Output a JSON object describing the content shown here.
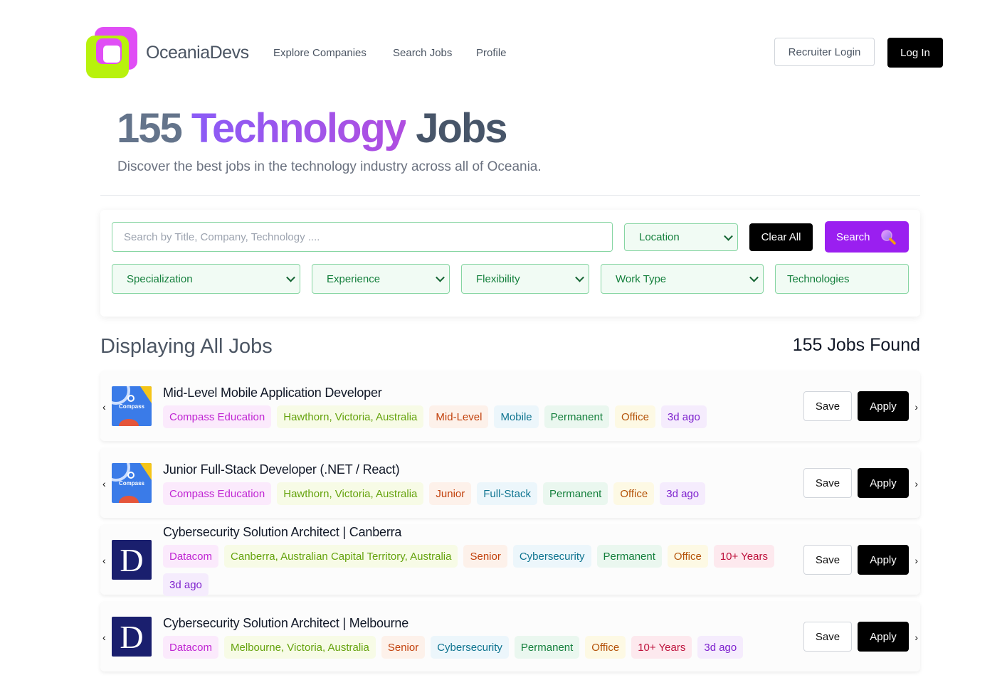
{
  "nav": {
    "brand": "OceaniaDevs",
    "links": [
      "Explore Companies",
      "Search Jobs",
      "Profile"
    ],
    "recruiter_login": "Recruiter Login",
    "log_in": "Log In"
  },
  "hero": {
    "count": "155",
    "accent": "Technology",
    "word": "Jobs",
    "subtitle": "Discover the best jobs in the technology industry across all of Oceania."
  },
  "filters": {
    "search_placeholder": "Search by Title, Company, Technology ....",
    "location": "Location",
    "clear_all": "Clear All",
    "search": "Search",
    "specialization": "Specialization",
    "experience": "Experience",
    "flexibility": "Flexibility",
    "work_type": "Work Type",
    "technologies_placeholder": "Technologies"
  },
  "list": {
    "title": "Displaying All Jobs",
    "found": "155 Jobs Found",
    "save_label": "Save",
    "apply_label": "Apply"
  },
  "jobs": [
    {
      "title": "Mid-Level Mobile Application Developer",
      "logo": "compass-logo",
      "logo_text": "Compass",
      "tags": {
        "company": "Compass Education",
        "location": "Hawthorn, Victoria, Australia",
        "level": "Mid-Level",
        "spec": "Mobile",
        "type": "Permanent",
        "flex": "Office",
        "age": "3d ago"
      }
    },
    {
      "title": "Junior Full-Stack Developer (.NET / React)",
      "logo": "compass-logo",
      "logo_text": "Compass",
      "tags": {
        "company": "Compass Education",
        "location": "Hawthorn, Victoria, Australia",
        "level": "Junior",
        "spec": "Full-Stack",
        "type": "Permanent",
        "flex": "Office",
        "age": "3d ago"
      }
    },
    {
      "title": "Cybersecurity Solution Architect | Canberra",
      "logo": "datacom-logo",
      "logo_text": "D",
      "tags": {
        "company": "Datacom",
        "location": "Canberra, Australian Capital Territory, Australia",
        "level": "Senior",
        "spec": "Cybersecurity",
        "type": "Permanent",
        "flex": "Office",
        "years": "10+ Years",
        "age": "3d ago"
      }
    },
    {
      "title": "Cybersecurity Solution Architect | Melbourne",
      "logo": "datacom-logo",
      "logo_text": "D",
      "tags": {
        "company": "Datacom",
        "location": "Melbourne, Victoria, Australia",
        "level": "Senior",
        "spec": "Cybersecurity",
        "type": "Permanent",
        "flex": "Office",
        "years": "10+ Years",
        "age": "3d ago"
      }
    }
  ],
  "icons": {
    "prev": "chevron-left-icon",
    "next": "chevron-right-icon",
    "search": "magnifier-icon"
  },
  "colors": {
    "accent": "#9a1ff0",
    "filter_border": "#86d5a2",
    "logo_pink": "#e04ef5",
    "logo_lime": "#b8f20c"
  }
}
